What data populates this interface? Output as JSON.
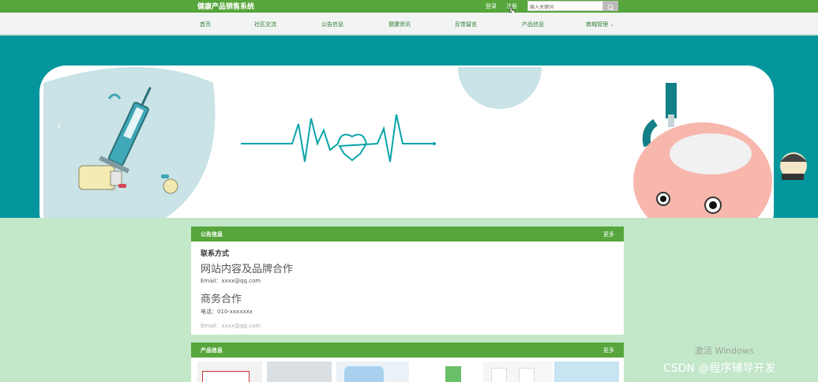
{
  "header": {
    "site_title": "健康产品销售系统",
    "login": "登录",
    "register": "注册",
    "search_placeholder": "输入关键词"
  },
  "nav": {
    "items": [
      "首页",
      "社区交流",
      "公告信息",
      "健康资讯",
      "反馈留言",
      "产品信息",
      "商城管理"
    ]
  },
  "notice": {
    "title": "公告信息",
    "more": "更多",
    "contact_title": "联系方式",
    "heading1": "网站内容及品牌合作",
    "email1": "Email：xxxx@qq.com",
    "heading2": "商务合作",
    "phone": "电话：010-xxxxxxx",
    "email2": "Email：xxxx@qq.com"
  },
  "products": {
    "title": "产品信息",
    "more": "更多"
  },
  "watermark": {
    "activate": "激活 Windows",
    "csdn": "CSDN @程序辅导开发"
  },
  "colors": {
    "green": "#56a63b",
    "teal": "#04969c",
    "page_bg": "#c2e7c9"
  }
}
